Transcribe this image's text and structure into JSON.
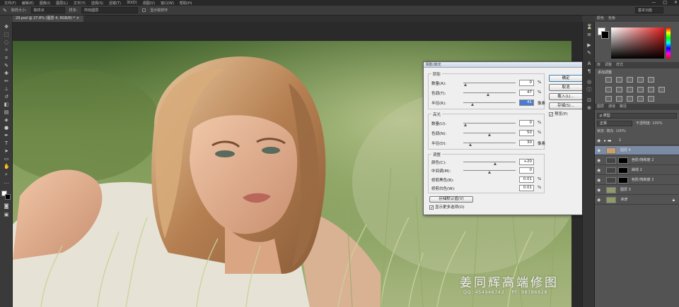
{
  "menubar": {
    "items": [
      "文件(F)",
      "编辑(E)",
      "图像(I)",
      "图层(L)",
      "文字(Y)",
      "选择(S)",
      "滤镜(T)",
      "3D(D)",
      "视图(V)",
      "窗口(W)",
      "帮助(H)"
    ],
    "min_icon": "—",
    "max_icon": "□",
    "close_icon": "✕"
  },
  "options": {
    "brush_size_label": "取样大小:",
    "brush_size_value": "取样点",
    "sample_label": "样本:",
    "sample_value": "所有图层",
    "show_ring": "显示取样环",
    "workspace": "基本功能"
  },
  "document": {
    "tab_title": "29.psd @ 27.8% (图层 4, RGB/8) *",
    "tab_close": "×"
  },
  "panels": {
    "color_tabs": [
      "颜色",
      "色板"
    ],
    "adjust_tabs": [
      "库",
      "调整",
      "样式"
    ],
    "adjust_title": "添加调整",
    "layers_tabs": [
      "图层",
      "通道",
      "路径"
    ],
    "filter_label": "ρ 类型",
    "blend_mode": "正常",
    "opacity": "不透明度: 100%",
    "lock": "锁定:          填充: 100%"
  },
  "layers": [
    {
      "name": "1",
      "type": "group"
    },
    {
      "name": "图层 4",
      "type": "selected"
    },
    {
      "name": "色阶/饱和度 2",
      "type": "adj"
    },
    {
      "name": "曲线 2",
      "type": "adj"
    },
    {
      "name": "色阶/饱和度 2",
      "type": "adj"
    },
    {
      "name": "图层 3",
      "type": "pixel"
    },
    {
      "name": "背景",
      "type": "bg"
    }
  ],
  "dialog": {
    "title": "阴影/高光",
    "close": "✕",
    "shadows": {
      "label": "阴影",
      "rows": [
        {
          "label": "数量(A):",
          "value": "0",
          "unit": "%",
          "pos": 0.02
        },
        {
          "label": "色调(T):",
          "value": "47",
          "unit": "%",
          "pos": 0.47
        },
        {
          "label": "半径(R):",
          "value": "41",
          "unit": "像素",
          "pos": 0.16
        }
      ]
    },
    "highlights": {
      "label": "高光",
      "rows": [
        {
          "label": "数量(U):",
          "value": "0",
          "unit": "%",
          "pos": 0.02
        },
        {
          "label": "色调(N):",
          "value": "50",
          "unit": "%",
          "pos": 0.5
        },
        {
          "label": "半径(D):",
          "value": "30",
          "unit": "像素",
          "pos": 0.12
        }
      ]
    },
    "adjust": {
      "label": "调整",
      "rows": [
        {
          "label": "颜色(C):",
          "value": "+20",
          "unit": "",
          "pos": 0.6
        },
        {
          "label": "中间调(M):",
          "value": "0",
          "unit": "",
          "pos": 0.5
        },
        {
          "label": "修剪黑色(B):",
          "value": "0.01",
          "unit": "%",
          "pos": null
        },
        {
          "label": "修剪白色(W):",
          "value": "0.01",
          "unit": "%",
          "pos": null
        }
      ]
    },
    "buttons": [
      "确定",
      "取消",
      "载入(L)...",
      "存储(S)..."
    ],
    "preview": "预览(P)",
    "save_default": "存储默认值(V)",
    "more_options": "显示更多选项(O)"
  },
  "watermark": {
    "title": "姜同辉高端修图",
    "qq": "QQ: 454946742",
    "pf": "PF: 98786628"
  }
}
